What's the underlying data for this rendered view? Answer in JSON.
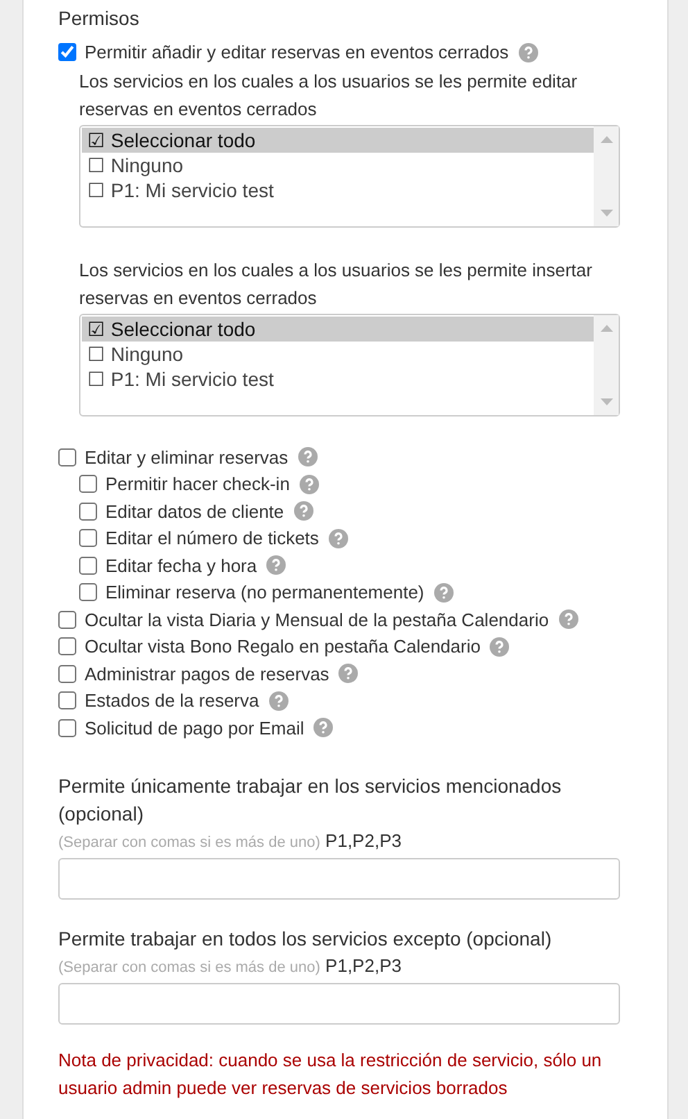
{
  "section_title": "Permisos",
  "closed_events": {
    "label": "Permitir añadir y editar reservas en eventos cerrados",
    "checked": true,
    "lists": [
      {
        "caption": "Los servicios en los cuales a los usuarios se les permite editar reservas en eventos cerrados",
        "options": [
          {
            "label": "☑ Seleccionar todo",
            "selected": true
          },
          {
            "label": "☐ Ninguno",
            "selected": false
          },
          {
            "label": "☐ P1: Mi servicio test",
            "selected": false
          }
        ]
      },
      {
        "caption": "Los servicios en los cuales a los usuarios se les permite insertar reservas en eventos cerrados",
        "options": [
          {
            "label": "☑ Seleccionar todo",
            "selected": true
          },
          {
            "label": "☐ Ninguno",
            "selected": false
          },
          {
            "label": "☐ P1: Mi servicio test",
            "selected": false
          }
        ]
      }
    ]
  },
  "permissions": [
    {
      "label": "Editar y eliminar reservas",
      "checked": false,
      "children": [
        {
          "label": "Permitir hacer check-in",
          "checked": false
        },
        {
          "label": "Editar datos de cliente",
          "checked": false
        },
        {
          "label": "Editar el número de tickets",
          "checked": false
        },
        {
          "label": "Editar fecha y hora",
          "checked": false
        },
        {
          "label": "Eliminar reserva (no permanentemente)",
          "checked": false
        }
      ]
    },
    {
      "label": "Ocultar la vista Diaria y Mensual de la pestaña Calendario",
      "checked": false
    },
    {
      "label": "Ocultar vista Bono Regalo en pestaña Calendario",
      "checked": false
    },
    {
      "label": "Administrar pagos de reservas",
      "checked": false
    },
    {
      "label": "Estados de la reserva",
      "checked": false
    },
    {
      "label": "Solicitud de pago por Email",
      "checked": false
    }
  ],
  "fields": [
    {
      "label": "Permite únicamente trabajar en los servicios mencionados (opcional)",
      "hint": "(Separar con comas si es más de uno)",
      "example": "P1,P2,P3"
    },
    {
      "label": "Permite trabajar en todos los servicios excepto (opcional)",
      "hint": "(Separar con comas si es más de uno)",
      "example": "P1,P2,P3"
    }
  ],
  "privacy_note": "Nota de privacidad: cuando se usa la restricción de servicio, sólo un usuario admin puede ver reservas de servicios borrados"
}
